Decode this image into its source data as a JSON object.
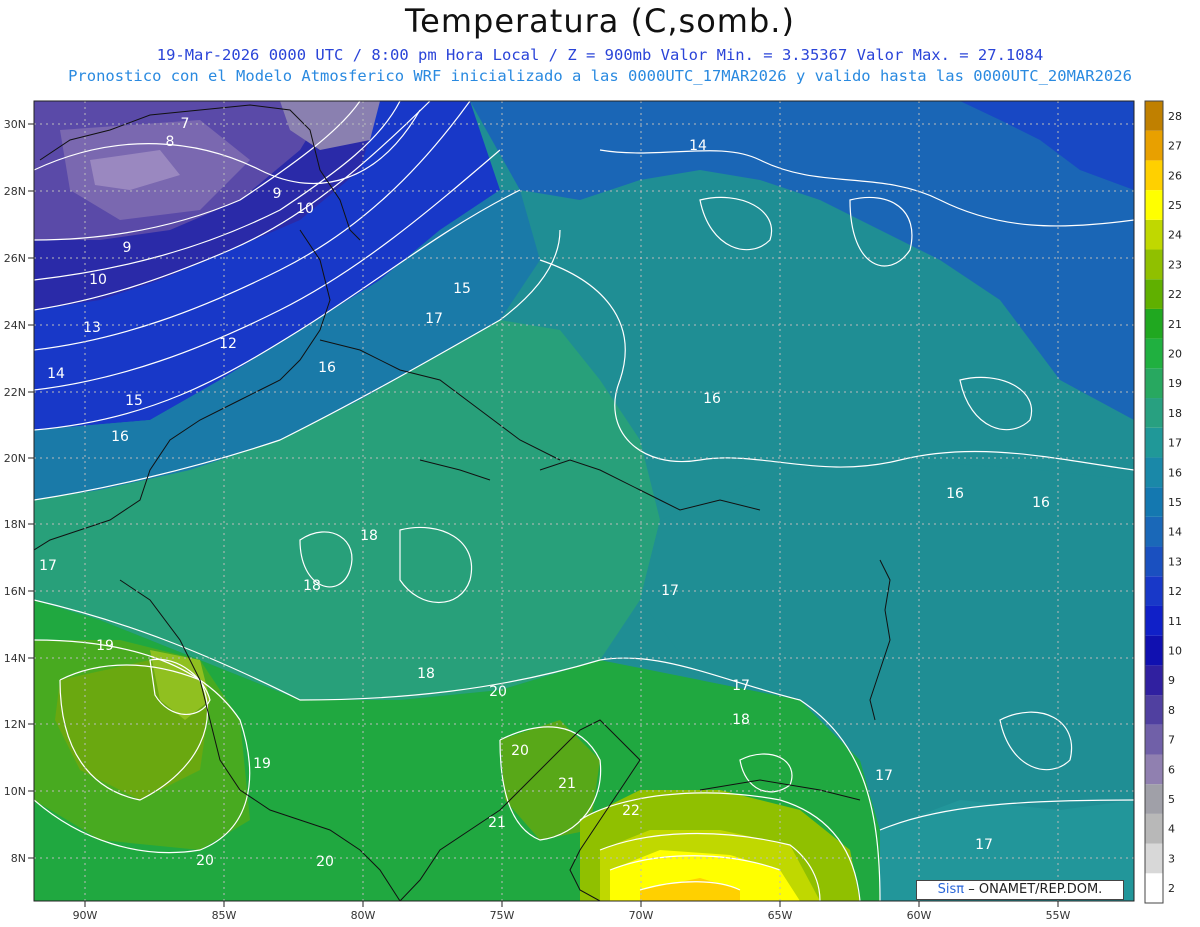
{
  "title": "Temperatura (C,somb.)",
  "subtitle_line1": "19-Mar-2026  0000 UTC / 8:00 pm Hora Local / Z = 900mb    Valor Min. = 3.35367  Valor Max. = 27.1084",
  "subtitle_line2": "Pronostico con el Modelo Atmosferico WRF inicializado a las 0000UTC_17MAR2026 y valido hasta las  0000UTC_20MAR2026",
  "credit": {
    "brand": "Sisπ",
    "text": "– ONAMET/REP.DOM."
  },
  "lat_labels": [
    "30N",
    "28N",
    "26N",
    "24N",
    "22N",
    "20N",
    "18N",
    "16N",
    "14N",
    "12N",
    "10N",
    "8N"
  ],
  "lon_labels": [
    "90W",
    "85W",
    "80W",
    "75W",
    "70W",
    "65W",
    "60W",
    "55W"
  ],
  "colorbar": {
    "levels": [
      "2",
      "3",
      "4",
      "5",
      "6",
      "7",
      "8",
      "9",
      "10",
      "11",
      "12",
      "13",
      "14",
      "15",
      "16",
      "17",
      "18",
      "19",
      "20",
      "21",
      "22",
      "23",
      "24",
      "25",
      "26",
      "27",
      "28"
    ],
    "colors": [
      "#ffffff",
      "#d8d8d8",
      "#b8b8b8",
      "#a0a0a8",
      "#9080b0",
      "#7060a8",
      "#5040a0",
      "#3020a0",
      "#1010b0",
      "#1020c8",
      "#1838c8",
      "#1a50c0",
      "#1a68b8",
      "#1478b0",
      "#1a88a8",
      "#209898",
      "#28a080",
      "#28a860",
      "#20b040",
      "#20a820",
      "#60b000",
      "#90c000",
      "#c0d800",
      "#ffff00",
      "#ffd000",
      "#e8a000",
      "#c08000"
    ]
  },
  "contour_labels": [
    {
      "text": "7"
    },
    {
      "text": "8"
    },
    {
      "text": "9"
    },
    {
      "text": "10"
    },
    {
      "text": "9"
    },
    {
      "text": "10"
    },
    {
      "text": "13"
    },
    {
      "text": "12"
    },
    {
      "text": "14"
    },
    {
      "text": "15"
    },
    {
      "text": "16"
    },
    {
      "text": "16"
    },
    {
      "text": "15"
    },
    {
      "text": "17"
    },
    {
      "text": "14"
    },
    {
      "text": "16"
    },
    {
      "text": "16"
    },
    {
      "text": "16"
    },
    {
      "text": "18"
    },
    {
      "text": "17"
    },
    {
      "text": "18"
    },
    {
      "text": "17"
    },
    {
      "text": "18"
    },
    {
      "text": "20"
    },
    {
      "text": "17"
    },
    {
      "text": "18"
    },
    {
      "text": "20"
    },
    {
      "text": "19"
    },
    {
      "text": "19"
    },
    {
      "text": "20"
    },
    {
      "text": "20"
    },
    {
      "text": "21"
    },
    {
      "text": "21"
    },
    {
      "text": "22"
    },
    {
      "text": "17"
    },
    {
      "text": "17"
    }
  ]
}
